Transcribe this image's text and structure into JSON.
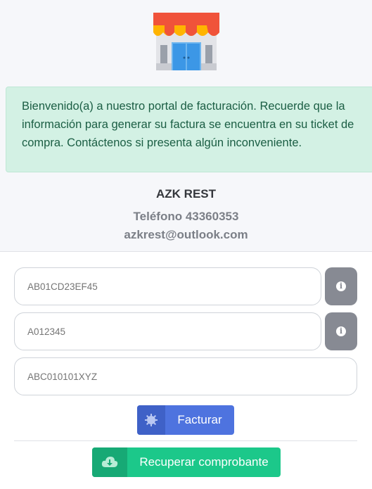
{
  "header": {
    "logo_icon": "storefront-icon"
  },
  "alert": {
    "message": "Bienvenido(a) a nuestro portal de facturación. Recuerde que la información para generar su factura se encuentra en su ticket de compra. Contáctenos si presenta algún inconveniente."
  },
  "business": {
    "name": "AZK REST",
    "phone": "Teléfono 43360353",
    "email": "azkrest@outlook.com"
  },
  "form": {
    "ticket_field": {
      "placeholder": "AB01CD23EF45",
      "info_icon": "info-circle-icon"
    },
    "code_field": {
      "placeholder": "A012345",
      "info_icon": "info-circle-icon"
    },
    "rfc_field": {
      "placeholder": "ABC010101XYZ"
    },
    "facturar_button": {
      "label": "Facturar",
      "icon": "gear-icon",
      "color": "#4e73df"
    },
    "recuperar_button": {
      "label": "Recuperar comprobante",
      "icon": "cloud-download-icon",
      "color": "#1cc88a"
    }
  },
  "colors": {
    "alert_bg": "#d3f1e4",
    "alert_text": "#1b5e44",
    "info_button": "#878a93"
  }
}
